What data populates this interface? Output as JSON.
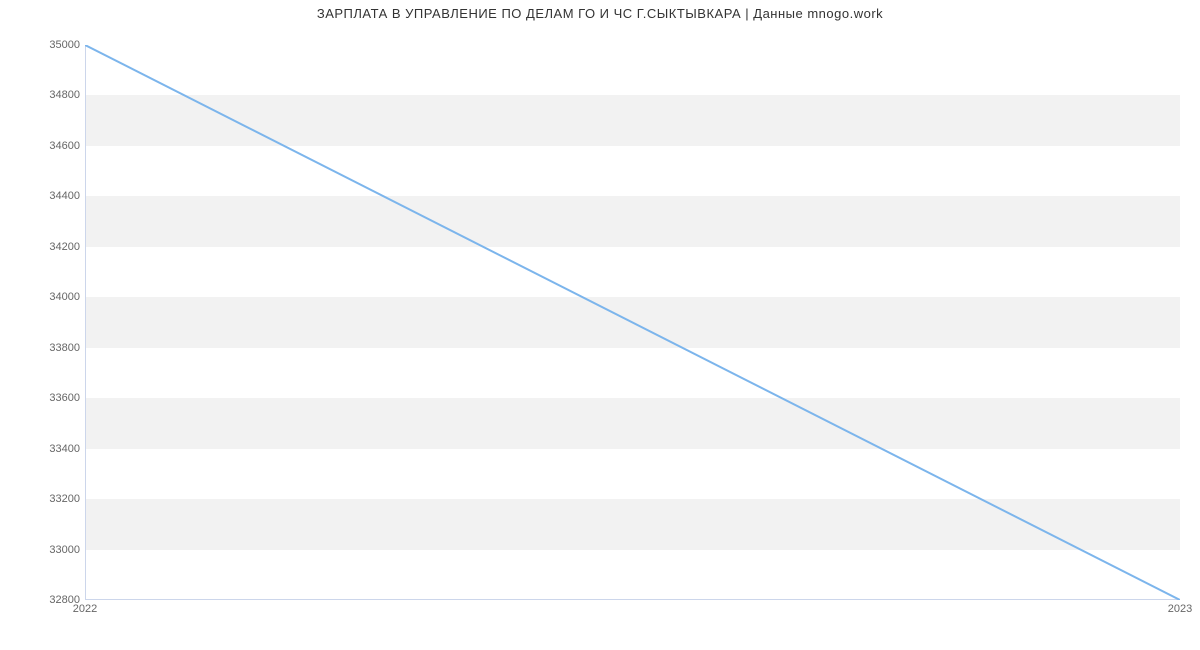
{
  "chart_data": {
    "type": "line",
    "title": "ЗАРПЛАТА В УПРАВЛЕНИЕ ПО ДЕЛАМ ГО И ЧС  Г.СЫКТЫВКАРА | Данные mnogo.work",
    "x": [
      "2022",
      "2023"
    ],
    "values": [
      35000,
      32800
    ],
    "xlabel": "",
    "ylabel": "",
    "ylim": [
      32800,
      35000
    ],
    "y_ticks": [
      32800,
      33000,
      33200,
      33400,
      33600,
      33800,
      34000,
      34200,
      34400,
      34600,
      34800,
      35000
    ],
    "x_ticks": [
      "2022",
      "2023"
    ],
    "line_color": "#7cb5ec",
    "band_color": "#f2f2f2"
  }
}
